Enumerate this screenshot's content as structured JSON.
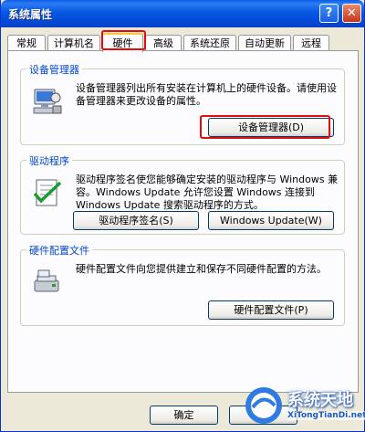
{
  "window": {
    "title": "系统属性",
    "help_icon": "question-mark-icon",
    "close_icon": "close-x-icon"
  },
  "tabs": [
    {
      "label": "常规"
    },
    {
      "label": "计算机名"
    },
    {
      "label": "硬件",
      "active": true
    },
    {
      "label": "高级"
    },
    {
      "label": "系统还原"
    },
    {
      "label": "自动更新"
    },
    {
      "label": "远程"
    }
  ],
  "device_manager": {
    "title": "设备管理器",
    "description": "设备管理器列出所有安装在计算机上的硬件设备。请使用设备管理器来更改设备的属性。",
    "button": "设备管理器(D)",
    "icon": "device-manager-icon"
  },
  "drivers": {
    "title": "驱动程序",
    "description": "驱动程序签名使您能够确定安装的驱动程序与 Windows 兼容。Windows Update 允许您设置 Windows 连接到 Windows Update 搜索驱动程序的方式。",
    "button_signing": "驱动程序签名(S)",
    "button_update": "Windows Update(W)",
    "icon": "driver-signing-checklist-icon"
  },
  "hardware_profiles": {
    "title": "硬件配置文件",
    "description": "硬件配置文件向您提供建立和保存不同硬件配置的方法。",
    "button": "硬件配置文件(P)",
    "icon": "hardware-profiles-icon"
  },
  "footer": {
    "ok": "确定",
    "cancel": "取"
  },
  "watermark": {
    "text": "系统天地",
    "url": "XiTongTianDi.net"
  },
  "colors": {
    "highlight_red": "#e20d0d",
    "title_blue": "#0757e3",
    "group_title": "#0046d5"
  }
}
